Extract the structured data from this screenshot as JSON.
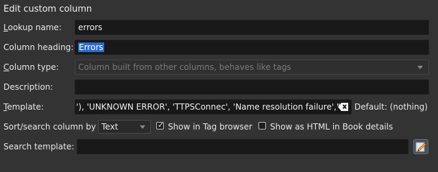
{
  "dialog": {
    "title": "Edit custom column"
  },
  "lookup": {
    "label_u": "L",
    "label_rest": "ookup name:",
    "value": "errors"
  },
  "heading": {
    "label": "Column heading:",
    "value": "Errors"
  },
  "coltype": {
    "label_u": "C",
    "label_rest": "olumn type:",
    "value": "Column built from other columns, behaves like tags"
  },
  "description": {
    "label": "Description:",
    "value": ""
  },
  "template": {
    "label_u": "T",
    "label_rest": "emplate:",
    "value": "'), 'UNKNOWN ERROR', 'TTPSConnec', 'Name resolution failure',\")",
    "default_label": "Default: (nothing)"
  },
  "sort": {
    "label": "Sort/search column by",
    "value": "Text",
    "tag_browser_label": "Show in Tag browser",
    "tag_browser_checked": true,
    "html_label": "Show as HTML in Book details",
    "html_checked": false
  },
  "search_template": {
    "label": "Search template:",
    "value": ""
  },
  "icons": {
    "clear": "clear-text-icon",
    "edit": "edit-template-icon",
    "dropdown": "chevron-down-icon",
    "check": "checkmark-icon"
  }
}
